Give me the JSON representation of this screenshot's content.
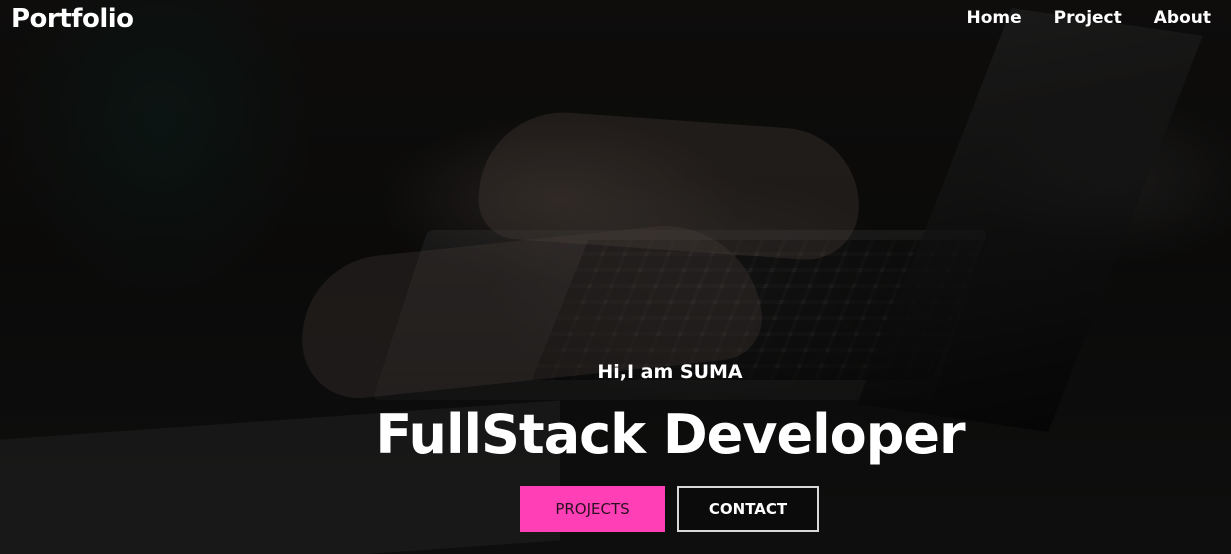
{
  "nav": {
    "logo": "Portfolio",
    "links": [
      {
        "label": "Home"
      },
      {
        "label": "Project"
      },
      {
        "label": "About"
      }
    ]
  },
  "hero": {
    "greeting": "Hi,I am SUMA",
    "title": "FullStack Developer",
    "buttons": {
      "projects": "PROJECTS",
      "contact": "CONTACT"
    }
  },
  "colors": {
    "accent": "#ff3fb5",
    "text": "#ffffff",
    "overlay": "#000000"
  }
}
